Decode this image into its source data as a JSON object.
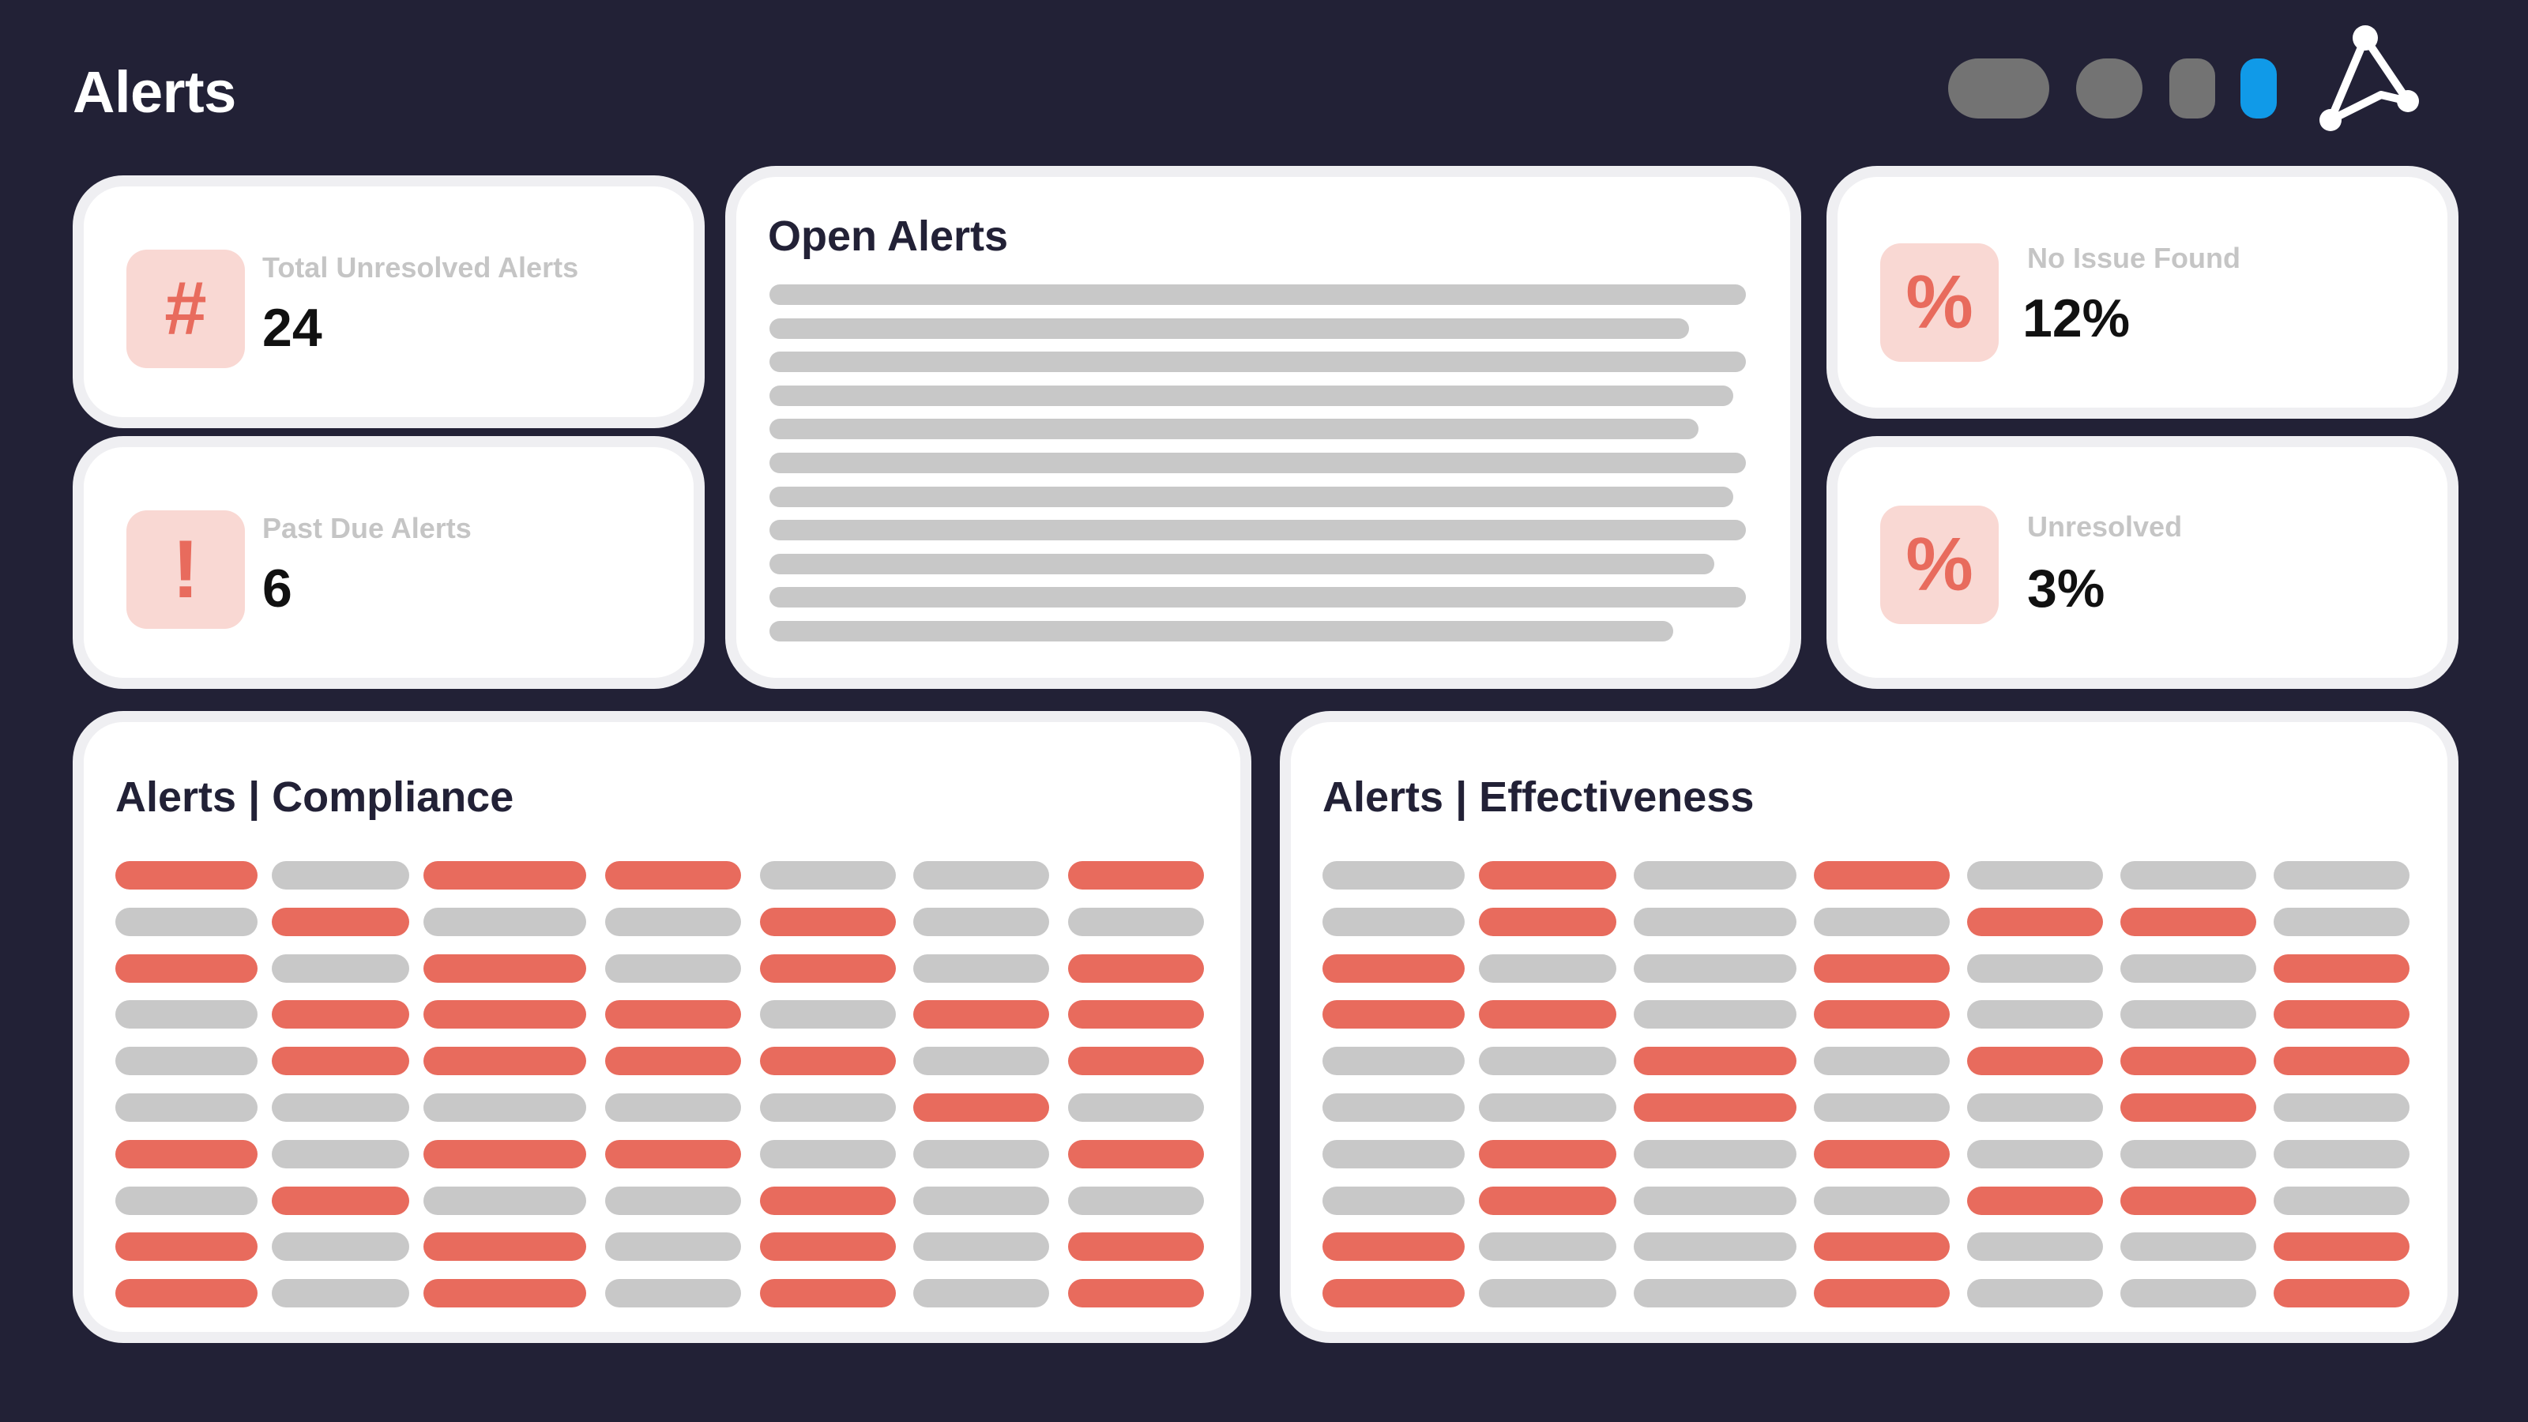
{
  "header": {
    "title": "Alerts",
    "icons": [
      "toggle-pill-icon",
      "toggle-pill-icon",
      "toggle-pill-icon",
      "active-indicator-icon",
      "triangle-network-logo-icon"
    ]
  },
  "colors": {
    "background": "#222136",
    "card": "#ffffff",
    "card_border": "#efeff2",
    "accent_red": "#e86b5d",
    "icon_bg": "#f9d8d3",
    "placeholder_gray": "#c8c8c8",
    "accent_blue": "#109ae8"
  },
  "stats": {
    "total_unresolved": {
      "label": "Total Unresolved Alerts",
      "value": "24",
      "icon_glyph": "#",
      "icon": "hash-icon"
    },
    "past_due": {
      "label": "Past Due Alerts",
      "value": "6",
      "icon_glyph": "!",
      "icon": "exclamation-icon"
    },
    "no_issue_found": {
      "label": "No Issue Found",
      "value": "12%",
      "icon_glyph": "%",
      "icon": "percent-icon"
    },
    "unresolved": {
      "label": "Unresolved",
      "value": "3%",
      "icon_glyph": "%",
      "icon": "percent-icon"
    }
  },
  "open_alerts": {
    "title": "Open Alerts",
    "placeholder_lines": 11
  },
  "compliance": {
    "title": "Alerts | Compliance",
    "grid": [
      "RGRRGGR",
      "GRGGRGG",
      "RGRGRGR",
      "GRRRGRR",
      "GRRRRGR",
      "GGGGGRG",
      "RGRRGGR",
      "GRGGRGG",
      "RGRGRGR",
      "RGRGRGR"
    ]
  },
  "effectiveness": {
    "title": "Alerts | Effectiveness",
    "grid": [
      "GRGRGGG",
      "GRGGRRG",
      "RGGRGGR",
      "RRGRGGR",
      "GGRGRRR",
      "GGRGGRG",
      "GRGRGGG",
      "GRGGRRG",
      "RGGRGGR",
      "RGGRGGR"
    ]
  }
}
